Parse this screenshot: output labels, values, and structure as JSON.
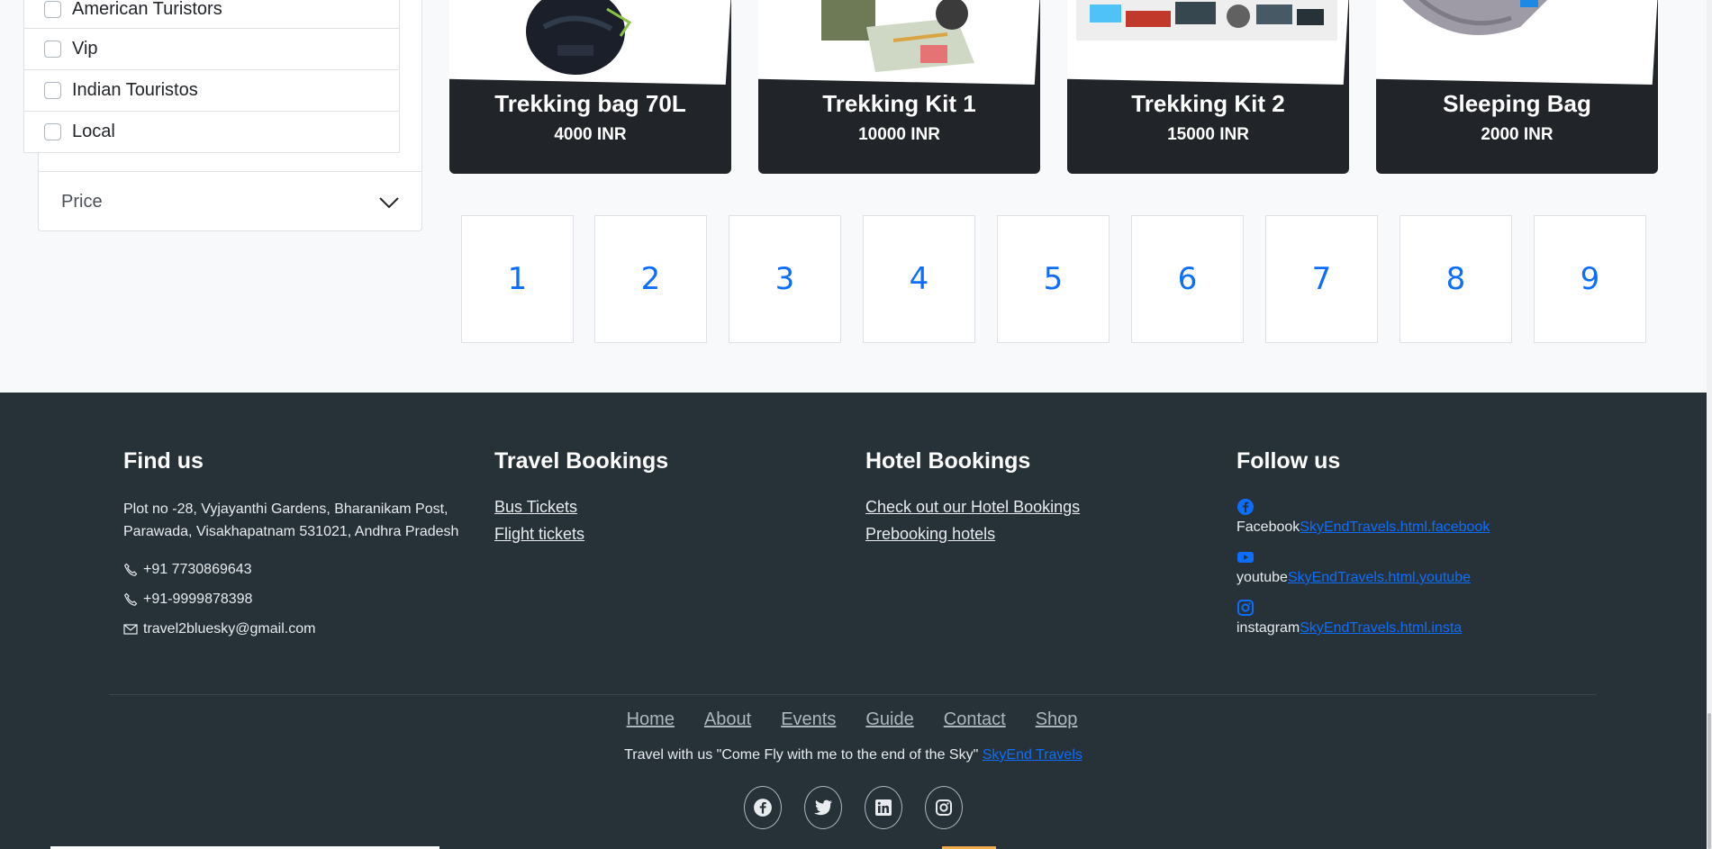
{
  "filters": {
    "brands": [
      "American Turistors",
      "Vip",
      "Indian Touristos",
      "Local"
    ],
    "price_label": "Price"
  },
  "products": [
    {
      "name": "Trekking bag 70L",
      "price": "4000 INR"
    },
    {
      "name": "Trekking Kit 1",
      "price": "10000 INR"
    },
    {
      "name": "Trekking Kit 2",
      "price": "15000 INR"
    },
    {
      "name": "Sleeping Bag",
      "price": "2000 INR"
    }
  ],
  "pagination": [
    "1",
    "2",
    "3",
    "4",
    "5",
    "6",
    "7",
    "8",
    "9"
  ],
  "footer": {
    "find_us": {
      "title": "Find us",
      "address": "Plot no -28, Vyjayanthi Gardens, Bharanikam Post, Parawada, Visakhapatnam 531021, Andhra Pradesh",
      "phone1": "+91 7730869643",
      "phone2": "+91-9999878398",
      "email": "travel2bluesky@gmail.com"
    },
    "travel": {
      "title": "Travel Bookings",
      "links": [
        "Bus Tickets",
        "Flight tickets"
      ]
    },
    "hotel": {
      "title": "Hotel Bookings",
      "links": [
        "Check out our Hotel Bookings",
        "Prebooking hotels"
      ]
    },
    "follow": {
      "title": "Follow us",
      "facebook_label": "Facebook",
      "facebook_link": "SkyEndTravels.html.facebook",
      "youtube_label": "youtube",
      "youtube_link": "SkyEndTravels.html.youtube",
      "instagram_label": "instagram",
      "instagram_link": "SkyEndTravels.html.insta"
    },
    "nav": [
      "Home",
      "About",
      "Events",
      "Guide",
      "Contact",
      "Shop"
    ],
    "tagline": "Travel with us \"Come Fly with me to the end of the Sky\"",
    "tagline_link": "SkyEnd Travels",
    "colors": {
      "footer_bg": "#263238",
      "link_blue": "#0d6efd",
      "card_dark": "#212529"
    }
  }
}
